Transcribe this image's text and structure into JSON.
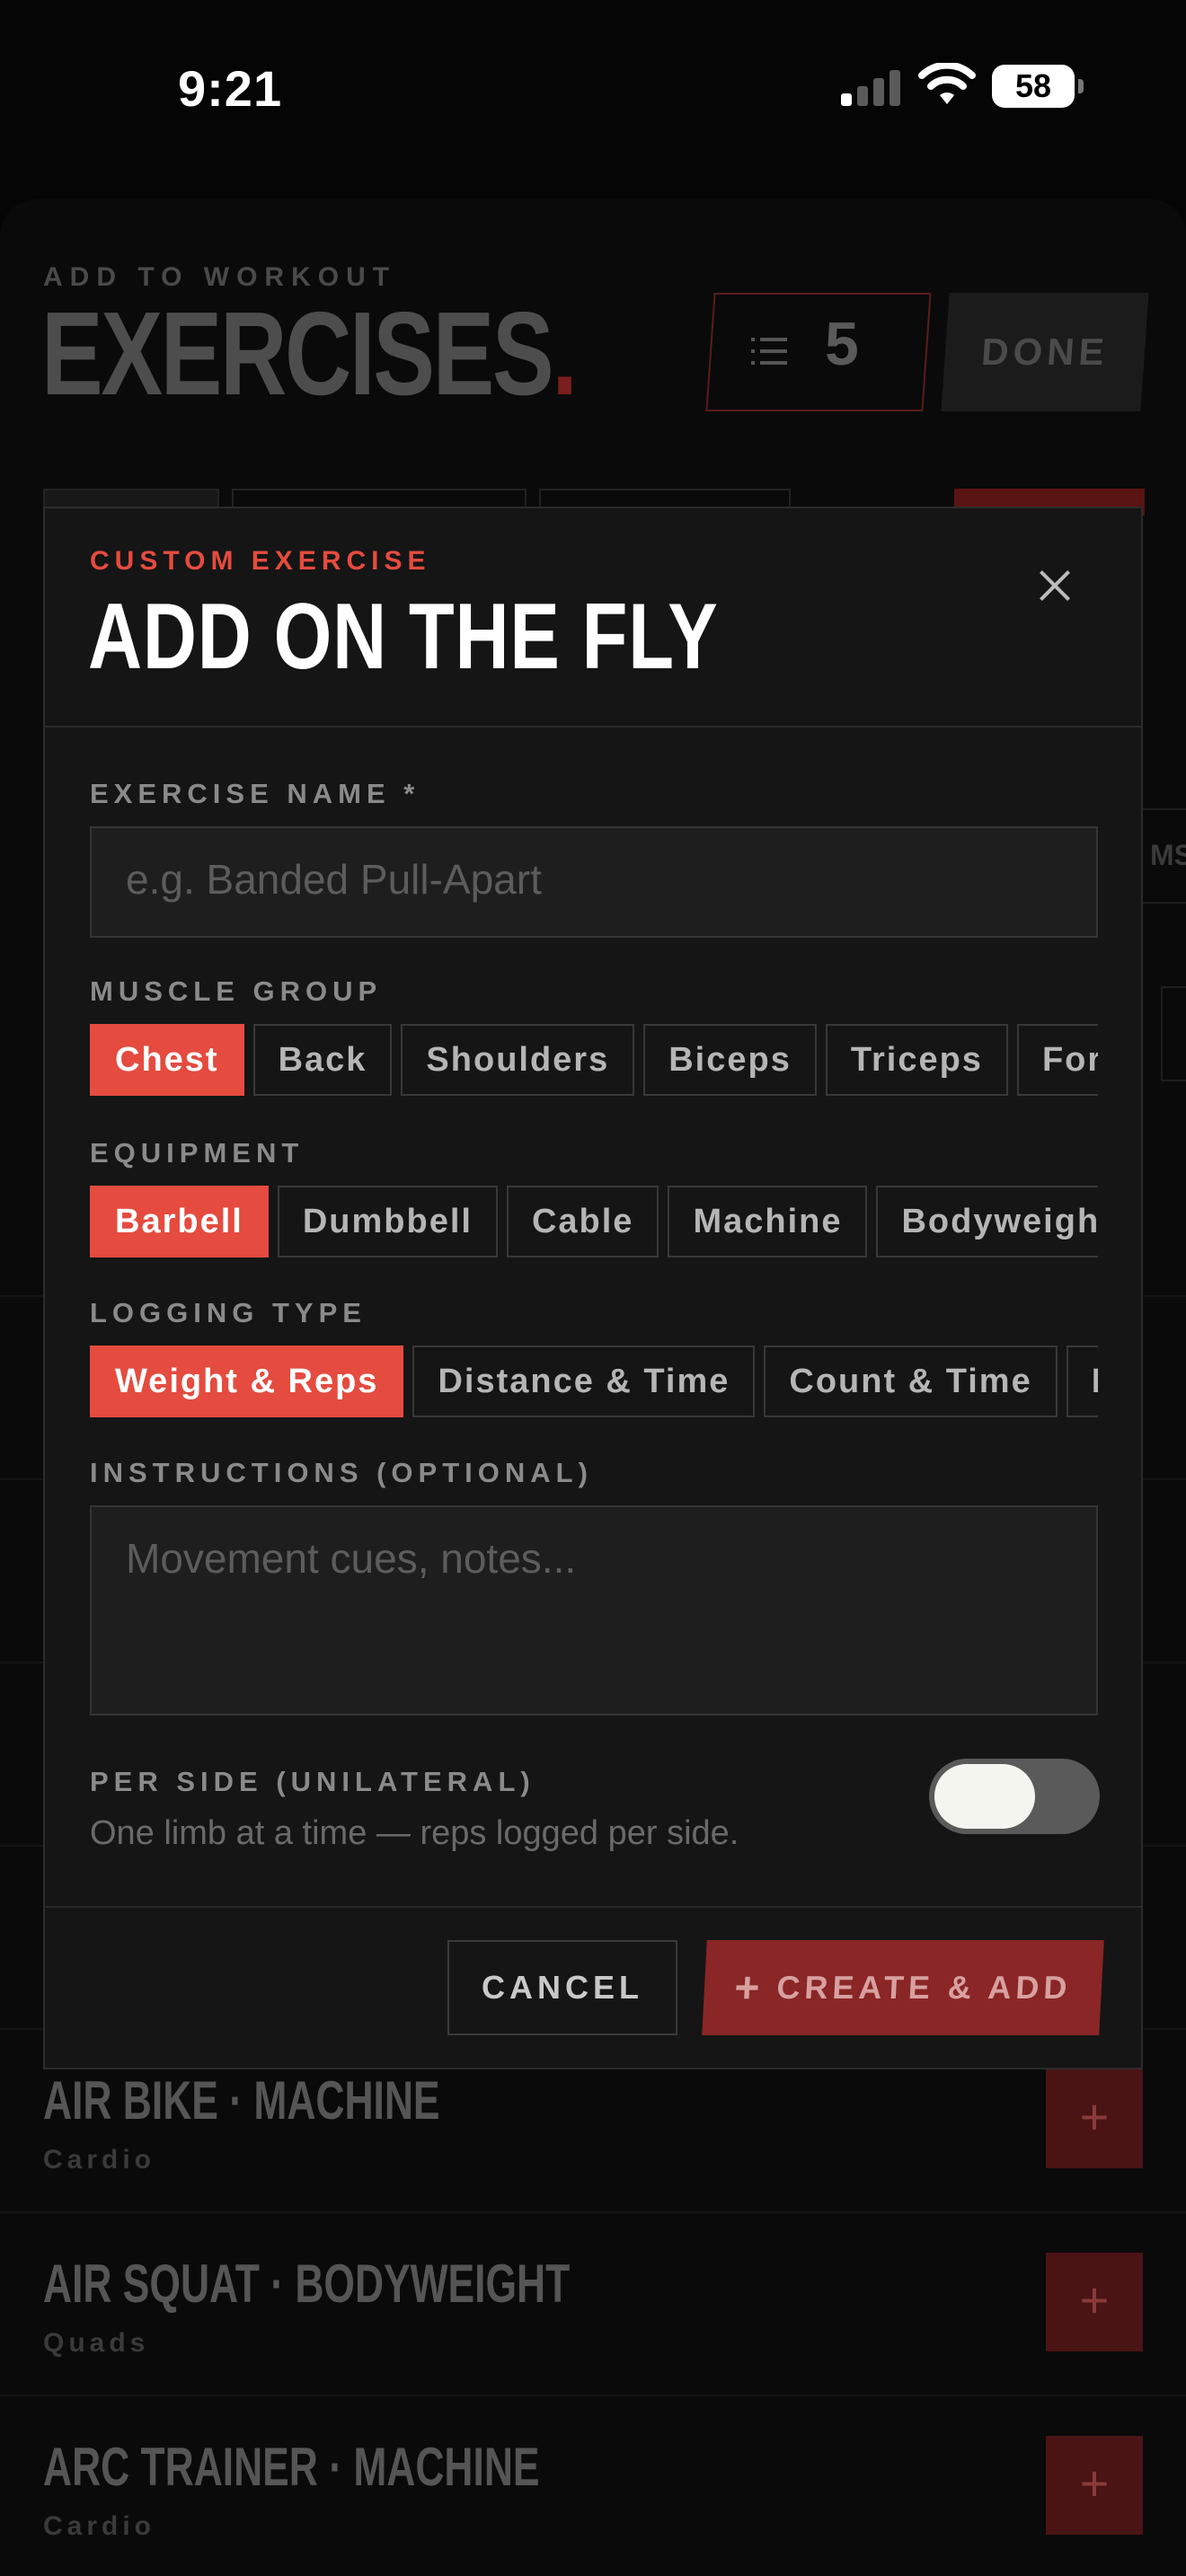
{
  "status_bar": {
    "time": "9:21",
    "battery": "58"
  },
  "header": {
    "eyebrow": "ADD TO WORKOUT",
    "title": "EXERCISES",
    "title_dot": ".",
    "count": "5",
    "done_label": "DONE"
  },
  "background": {
    "side_label": "MS"
  },
  "exercise_list": [
    {
      "title": "AIR BIKE · MACHINE",
      "subtitle": "Cardio",
      "add_label": "+"
    },
    {
      "title": "AIR SQUAT · BODYWEIGHT",
      "subtitle": "Quads",
      "add_label": "+"
    },
    {
      "title": "ARC TRAINER · MACHINE",
      "subtitle": "Cardio",
      "add_label": "+"
    }
  ],
  "modal": {
    "eyebrow": "CUSTOM EXERCISE",
    "title": "ADD ON THE FLY",
    "exercise_name": {
      "label": "EXERCISE NAME *",
      "value": "",
      "placeholder": "e.g. Banded Pull-Apart"
    },
    "muscle_group": {
      "label": "MUSCLE GROUP",
      "options": [
        "Chest",
        "Back",
        "Shoulders",
        "Biceps",
        "Triceps",
        "Forearms"
      ],
      "selected": "Chest"
    },
    "equipment": {
      "label": "EQUIPMENT",
      "options": [
        "Barbell",
        "Dumbbell",
        "Cable",
        "Machine",
        "Bodyweight"
      ],
      "selected": "Barbell"
    },
    "logging_type": {
      "label": "LOGGING TYPE",
      "options": [
        "Weight & Reps",
        "Distance & Time",
        "Count & Time",
        "Hold"
      ],
      "selected": "Weight & Reps"
    },
    "instructions": {
      "label": "INSTRUCTIONS (OPTIONAL)",
      "value": "",
      "placeholder": "Movement cues, notes..."
    },
    "per_side": {
      "label": "PER SIDE (UNILATERAL)",
      "hint": "One limb at a time — reps logged per side.",
      "enabled": false
    },
    "cancel_label": "CANCEL",
    "create_label": "CREATE & ADD",
    "create_icon": "plus-icon"
  },
  "colors": {
    "accent": "#e54b3f",
    "background": "#050505",
    "modal": "#151515"
  }
}
